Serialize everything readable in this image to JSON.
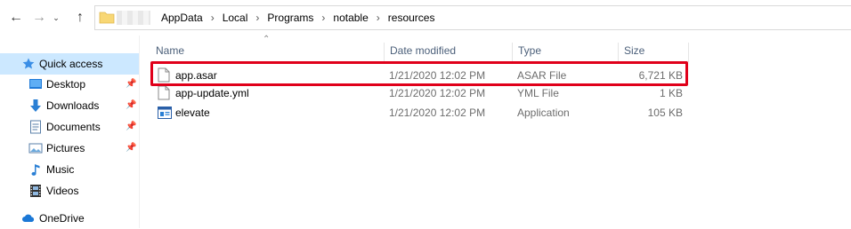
{
  "breadcrumbs": [
    "AppData",
    "Local",
    "Programs",
    "notable",
    "resources"
  ],
  "nav": {
    "items": [
      {
        "label": "Quick access",
        "icon": "star-icon",
        "pinned": false,
        "selected": true
      },
      {
        "label": "Desktop",
        "icon": "desktop-icon",
        "pinned": true
      },
      {
        "label": "Downloads",
        "icon": "download-arrow-icon",
        "pinned": true
      },
      {
        "label": "Documents",
        "icon": "documents-icon",
        "pinned": true
      },
      {
        "label": "Pictures",
        "icon": "pictures-icon",
        "pinned": true
      },
      {
        "label": "Music",
        "icon": "music-note-icon",
        "pinned": false
      },
      {
        "label": "Videos",
        "icon": "film-icon",
        "pinned": false
      },
      {
        "label": "OneDrive",
        "icon": "cloud-icon",
        "pinned": false
      }
    ]
  },
  "columns": {
    "name": "Name",
    "date": "Date modified",
    "type": "Type",
    "size": "Size"
  },
  "files": [
    {
      "name": "app.asar",
      "date": "1/21/2020 12:02 PM",
      "type": "ASAR File",
      "size": "6,721 KB",
      "icon": "file-icon"
    },
    {
      "name": "app-update.yml",
      "date": "1/21/2020 12:02 PM",
      "type": "YML File",
      "size": "1 KB",
      "icon": "file-icon"
    },
    {
      "name": "elevate",
      "date": "1/21/2020 12:02 PM",
      "type": "Application",
      "size": "105 KB",
      "icon": "application-icon"
    }
  ],
  "highlight_color": "#e0001a",
  "selection_color": "#cce8ff"
}
